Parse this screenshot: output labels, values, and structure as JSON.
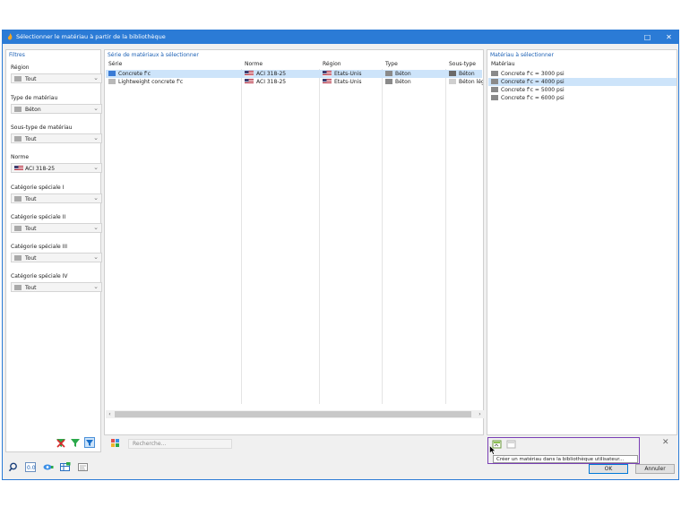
{
  "window": {
    "title": "Sélectionner le matériau à partir de la bibliothèque",
    "restore_glyph": "□",
    "close_glyph": "✕"
  },
  "filters": {
    "header": "Filtres",
    "items": [
      {
        "label": "Région",
        "value": "Tout",
        "icon": "swatch-icon"
      },
      {
        "label": "Type de matériau",
        "value": "Béton",
        "icon": "swatch-icon"
      },
      {
        "label": "Sous-type de matériau",
        "value": "Tout",
        "icon": "swatch-icon"
      },
      {
        "label": "Norme",
        "value": "ACI 318-25",
        "icon": "us-flag-icon"
      },
      {
        "label": "Catégorie spéciale I",
        "value": "Tout",
        "icon": "swatch-icon"
      },
      {
        "label": "Catégorie spéciale II",
        "value": "Tout",
        "icon": "swatch-icon"
      },
      {
        "label": "Catégorie spéciale III",
        "value": "Tout",
        "icon": "swatch-icon"
      },
      {
        "label": "Catégorie spéciale IV",
        "value": "Tout",
        "icon": "swatch-icon"
      }
    ]
  },
  "series": {
    "header": "Série de matériaux à sélectionner",
    "columns": [
      "Série",
      "Norme",
      "Région",
      "Type",
      "Sous-type"
    ],
    "rows": [
      {
        "serie": "Concrete f'c",
        "norme": "ACI 318-25",
        "region": "États-Unis",
        "type": "Béton",
        "soustype": "Béton",
        "selected": true
      },
      {
        "serie": "Lightweight concrete f'c",
        "norme": "ACI 318-25",
        "region": "États-Unis",
        "type": "Béton",
        "soustype": "Béton légé",
        "selected": false
      }
    ],
    "search_placeholder": "Recherche..."
  },
  "materials": {
    "header": "Matériau à sélectionner",
    "column": "Matériau",
    "items": [
      {
        "label": "Concrete f'c = 3000 psi",
        "selected": false
      },
      {
        "label": "Concrete f'c = 4000 psi",
        "selected": true
      },
      {
        "label": "Concrete f'c = 5000 psi",
        "selected": false
      },
      {
        "label": "Concrete f'c = 6000 psi",
        "selected": false
      }
    ]
  },
  "tooltip": "Créer un matériau dans la bibliothèque utilisateur...",
  "buttons": {
    "ok": "OK",
    "cancel": "Annuler"
  },
  "colors": {
    "accent": "#2b7bd6",
    "selection": "#cde4fa",
    "highlight": "#7a3fb5"
  }
}
